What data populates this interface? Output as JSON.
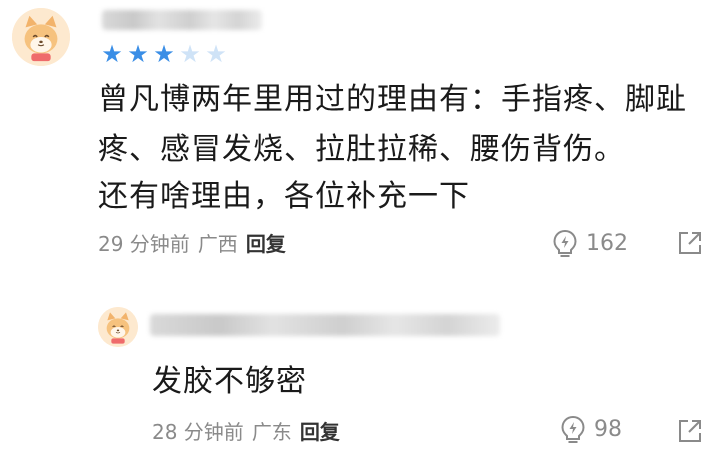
{
  "comments": [
    {
      "stars": {
        "filled": 3,
        "total": 5,
        "filled_color": "#3a8ee6",
        "empty_color": "#cfe3f7"
      },
      "text_lines": [
        "曾凡博两年里用过的理由有：手指疼、脚趾",
        "疼、感冒发烧、拉肚拉稀、腰伤背伤。",
        "还有啥理由，各位补充一下"
      ],
      "time": "29 分钟前",
      "location": "广西",
      "reply_label": "回复",
      "like_count": "162"
    },
    {
      "text_lines": [
        "发胶不够密"
      ],
      "time": "28 分钟前",
      "location": "广东",
      "reply_label": "回复",
      "like_count": "98"
    }
  ],
  "icons": {
    "avatar": "fox-avatar-icon",
    "like": "lightbulb-like-icon",
    "share": "share-arrow-icon"
  }
}
